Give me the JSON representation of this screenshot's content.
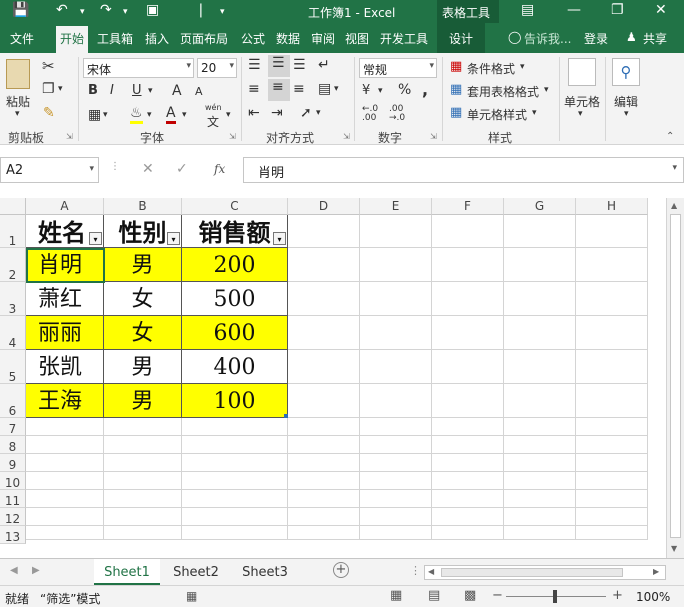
{
  "window": {
    "title": "工作簿1 - Excel",
    "context_tab_group": "表格工具"
  },
  "tabs": [
    {
      "label": "文件"
    },
    {
      "label": "开始"
    },
    {
      "label": "工具箱"
    },
    {
      "label": "插入"
    },
    {
      "label": "页面布局"
    },
    {
      "label": "公式"
    },
    {
      "label": "数据"
    },
    {
      "label": "审阅"
    },
    {
      "label": "视图"
    },
    {
      "label": "开发工具"
    },
    {
      "label": "设计"
    }
  ],
  "tell_me": "告诉我...",
  "login": "登录",
  "share": "共享",
  "ribbon": {
    "paste": "粘贴",
    "font_name": "宋体",
    "font_size": "20",
    "bold": "B",
    "italic": "I",
    "underline": "U",
    "grow_font": "A",
    "shrink_font": "A",
    "wen": "wén",
    "wen_char": "文",
    "number_format": "常规",
    "currency": "¥",
    "percent": "%",
    "comma": ",",
    "conditional_format": "条件格式",
    "table_format": "套用表格格式",
    "cell_style": "单元格样式",
    "cells": "单元格",
    "editing": "编辑",
    "groups": {
      "clipboard": "剪贴板",
      "font": "字体",
      "alignment": "对齐方式",
      "number": "数字",
      "styles": "样式"
    }
  },
  "formula_bar": {
    "name_box": "A2",
    "fx": "fx",
    "content": "肖明"
  },
  "columns": [
    "A",
    "B",
    "C",
    "D",
    "E",
    "F",
    "G",
    "H"
  ],
  "rows": [
    "1",
    "2",
    "3",
    "4",
    "5",
    "6",
    "7",
    "8",
    "9",
    "10",
    "11",
    "12",
    "13"
  ],
  "table": {
    "headers": [
      "姓名",
      "性别",
      "销售额"
    ],
    "rows": [
      [
        "肖明",
        "男",
        "200"
      ],
      [
        "萧红",
        "女",
        "500"
      ],
      [
        "丽丽",
        "女",
        "600"
      ],
      [
        "张凯",
        "男",
        "400"
      ],
      [
        "王海",
        "男",
        "100"
      ]
    ],
    "highlight_color": "#ffff00"
  },
  "sheets": [
    "Sheet1",
    "Sheet2",
    "Sheet3"
  ],
  "status": {
    "ready": "就绪",
    "mode": "“筛选”模式",
    "zoom": "100%"
  },
  "colors": {
    "excel_green": "#217346",
    "context_green": "#185c37"
  }
}
